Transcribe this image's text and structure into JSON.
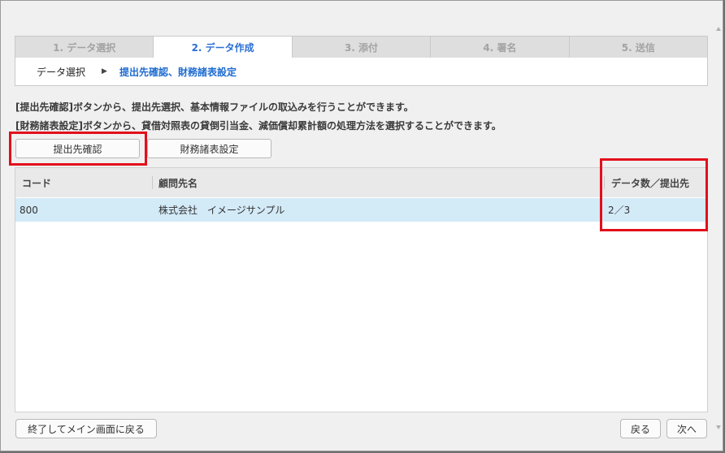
{
  "wizard": {
    "steps": [
      {
        "label": "1. データ選択"
      },
      {
        "label": "2. データ作成"
      },
      {
        "label": "3. 添付"
      },
      {
        "label": "4. 署名"
      },
      {
        "label": "5. 送信"
      }
    ],
    "active_step": 1
  },
  "breadcrumb": {
    "item1": "データ選択",
    "arrow": "▶",
    "item2": "提出先確認、財務諸表設定"
  },
  "description": {
    "line1": "[提出先確認]ボタンから、提出先選択、基本情報ファイルの取込みを行うことができます。",
    "line2": "[財務諸表設定]ボタンから、貸借対照表の貸倒引当金、減価償却累計額の処理方法を選択することができます。"
  },
  "actions": {
    "confirm_label": "提出先確認",
    "fs_settings_label": "財務諸表設定"
  },
  "table": {
    "columns": {
      "code": "コード",
      "client": "顧問先名",
      "count": "データ数／提出先"
    },
    "rows": [
      {
        "code": "800",
        "client": "株式会社　イメージサンプル",
        "count": "2／3"
      }
    ]
  },
  "footer": {
    "exit_label": "終了してメイン画面に戻る",
    "back_label": "戻る",
    "next_label": "次へ"
  },
  "colors": {
    "highlight": "#e20f1b",
    "accent": "#2a6fd6",
    "selected_row": "#d3eaf7"
  }
}
